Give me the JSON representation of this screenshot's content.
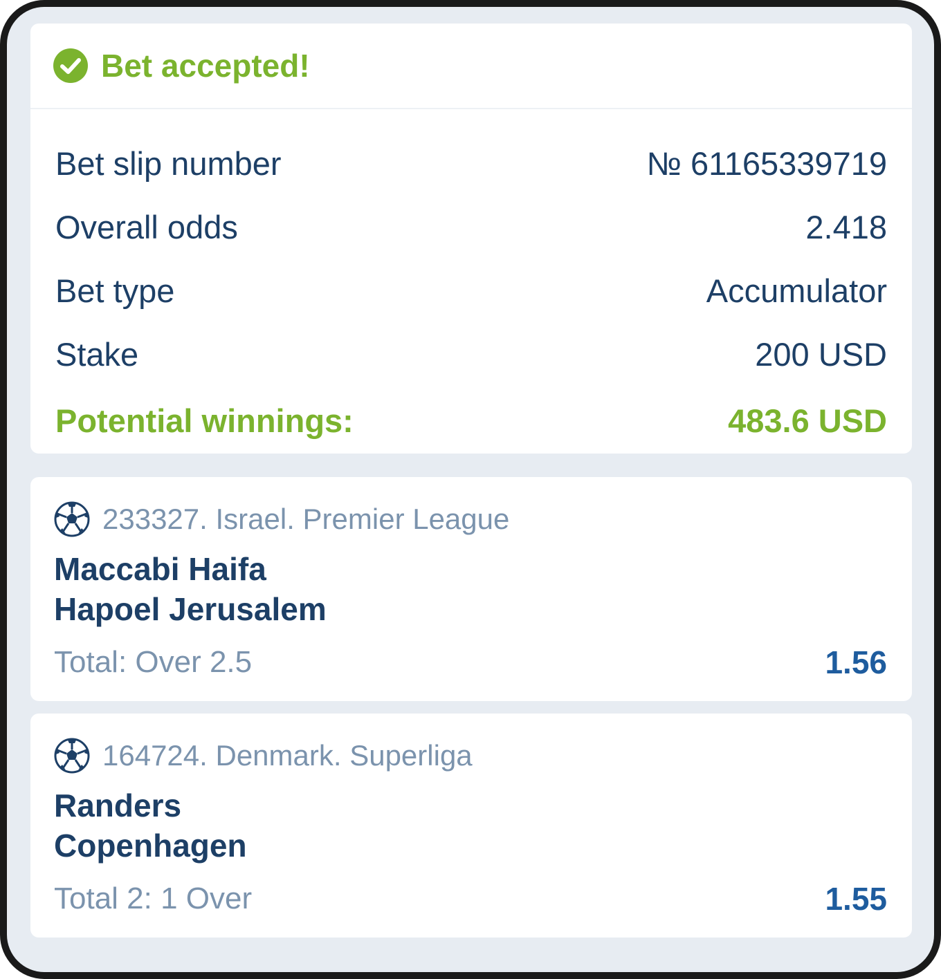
{
  "status": {
    "title": "Bet accepted!",
    "icon": "check-circle-icon",
    "color": "#7bb32e"
  },
  "summary": {
    "rows": [
      {
        "label": "Bet slip number",
        "value": "№ 61165339719"
      },
      {
        "label": "Overall odds",
        "value": "2.418"
      },
      {
        "label": "Bet type",
        "value": "Accumulator"
      },
      {
        "label": "Stake",
        "value": "200 USD"
      },
      {
        "label": "Potential winnings:",
        "value": "483.6 USD"
      }
    ]
  },
  "events": [
    {
      "icon": "soccer-ball-icon",
      "league": "233327. Israel. Premier League",
      "team1": "Maccabi Haifa",
      "team2": "Hapoel Jerusalem",
      "outcome": "Total: Over 2.5",
      "odds": "1.56"
    },
    {
      "icon": "soccer-ball-icon",
      "league": "164724. Denmark. Superliga",
      "team1": "Randers",
      "team2": "Copenhagen",
      "outcome": "Total 2: 1 Over",
      "odds": "1.55"
    }
  ],
  "colors": {
    "accent_green": "#7bb32e",
    "text_navy": "#1d3f66",
    "muted": "#7b93ad",
    "odds_blue": "#1e5c9e",
    "background": "#e7ecf2"
  }
}
